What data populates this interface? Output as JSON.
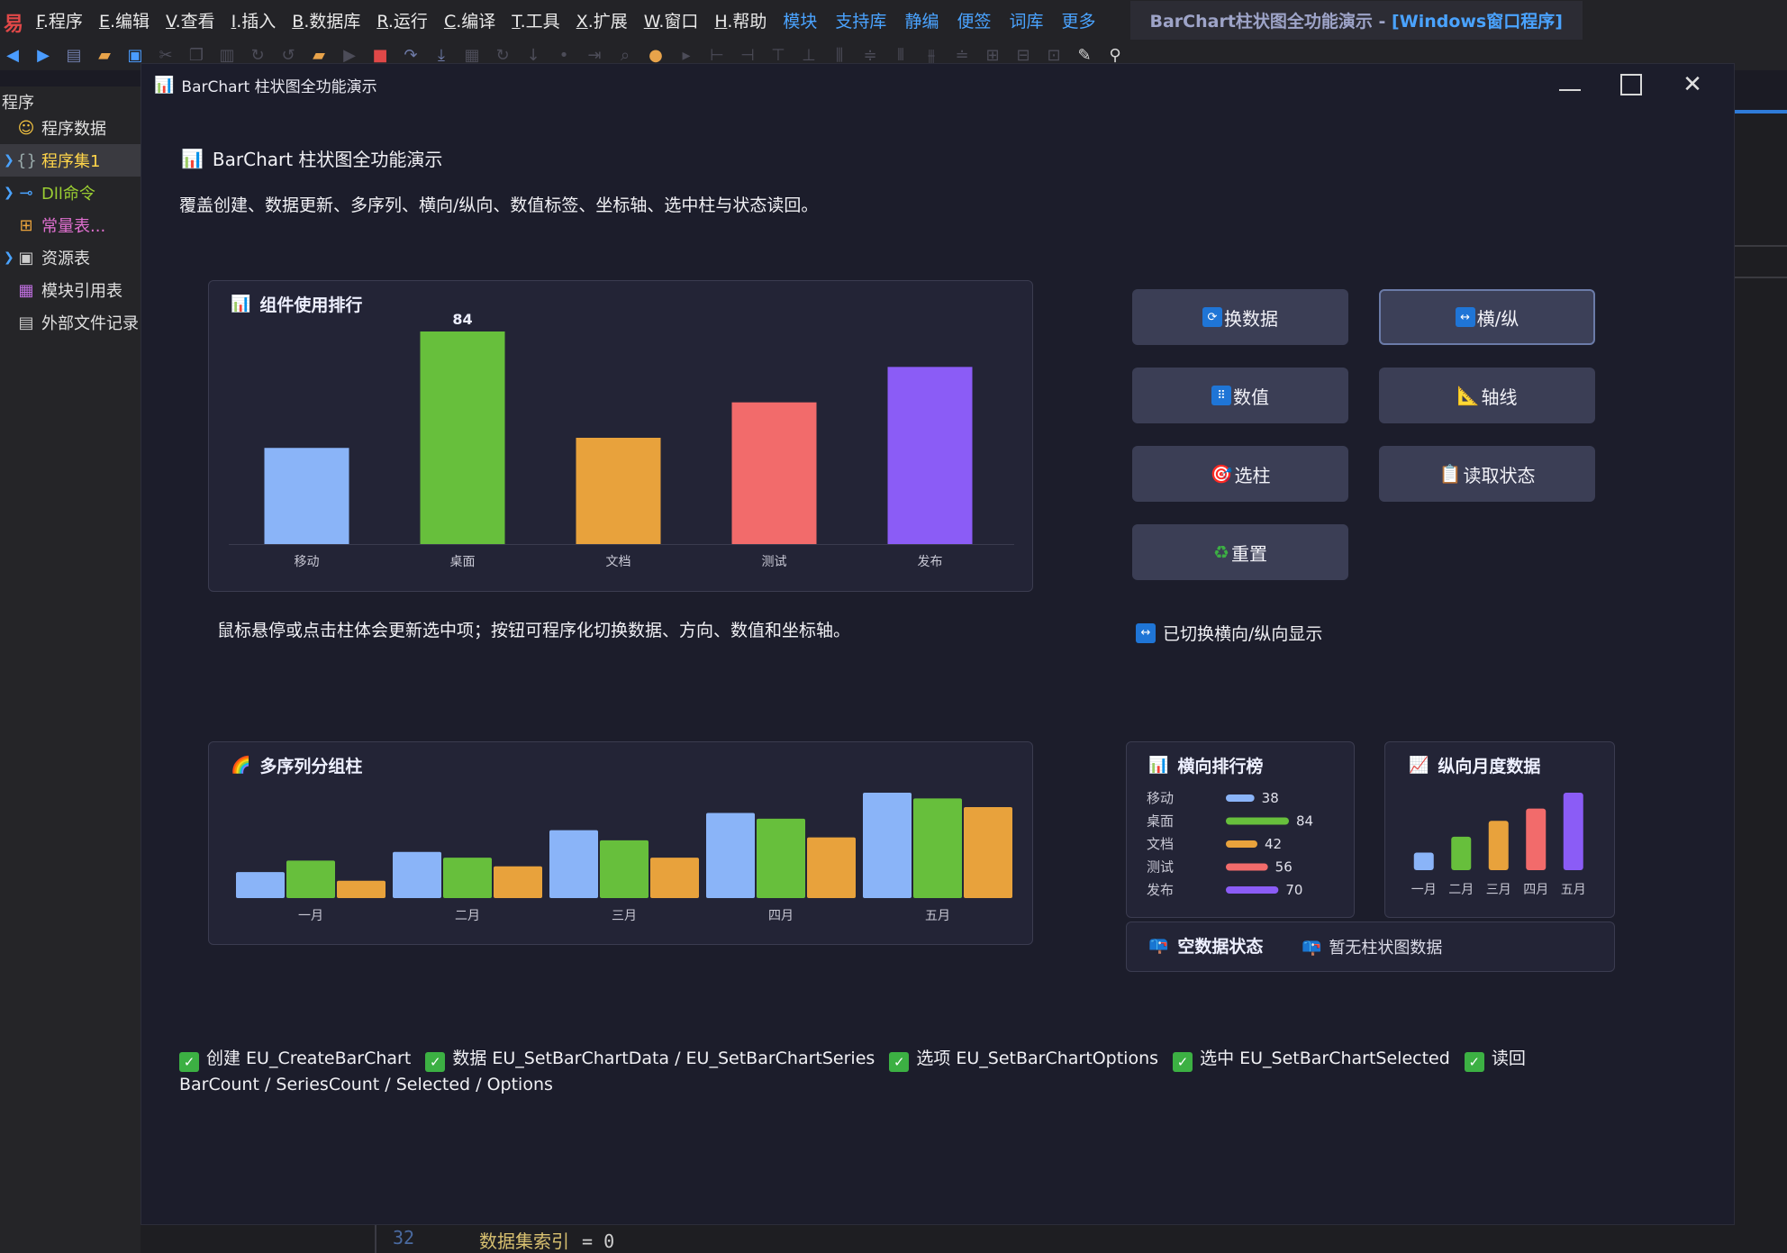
{
  "ide": {
    "menus": [
      {
        "key": "F",
        "label": ".程序"
      },
      {
        "key": "E",
        "label": ".编辑"
      },
      {
        "key": "V",
        "label": ".查看"
      },
      {
        "key": "I",
        "label": ".插入"
      },
      {
        "key": "B",
        "label": ".数据库"
      },
      {
        "key": "R",
        "label": ".运行"
      },
      {
        "key": "C",
        "label": ".编译"
      },
      {
        "key": "T",
        "label": ".工具"
      },
      {
        "key": "X",
        "label": ".扩展"
      },
      {
        "key": "W",
        "label": ".窗口"
      },
      {
        "key": "H",
        "label": ".帮助"
      }
    ],
    "links": [
      "模块",
      "支持库",
      "静编",
      "便签",
      "词库",
      "更多"
    ],
    "title_main": "BarChart柱状图全功能演示 - ",
    "title_sub": "[Windows窗口程序]",
    "sidebar_header": "程序",
    "sidebar_items": [
      {
        "label": "程序数据",
        "icon": "smiley-icon"
      },
      {
        "label": "程序集1",
        "icon": "braces-icon"
      },
      {
        "label": "Dll命令",
        "icon": "dll-icon"
      },
      {
        "label": "常量表...",
        "icon": "constant-icon"
      },
      {
        "label": "资源表",
        "icon": "resource-icon"
      },
      {
        "label": "模块引用表",
        "icon": "module-icon"
      },
      {
        "label": "外部文件记录",
        "icon": "file-icon"
      }
    ],
    "code_line_number": "32",
    "code_text": "数据集索引",
    "code_op": "=  0"
  },
  "window": {
    "title": "BarChart 柱状图全功能演示"
  },
  "page": {
    "title": "BarChart 柱状图全功能演示",
    "description": "覆盖创建、数据更新、多序列、横向/纵向、数值标签、坐标轴、选中柱与状态读回。",
    "hint": "鼠标悬停或点击柱体会更新选中项；按钮可程序化切换数据、方向、数值和坐标轴。",
    "status": "已切换横向/纵向显示",
    "empty_title": "空数据状态",
    "empty_text": "暂无柱状图数据"
  },
  "buttons": {
    "change_data": "换数据",
    "orientation": "横/纵",
    "values": "数值",
    "axis": "轴线",
    "select": "选柱",
    "read_state": "读取状态",
    "reset": "重置"
  },
  "api": [
    {
      "label": "创建 EU_CreateBarChart"
    },
    {
      "label": "数据 EU_SetBarChartData / EU_SetBarChartSeries"
    },
    {
      "label": "选项 EU_SetBarChartOptions"
    },
    {
      "label": "选中 EU_SetBarChartSelected"
    },
    {
      "label": "读回 BarCount / SeriesCount / Selected / Options"
    }
  ],
  "colors": {
    "blue": "#8ab4f8",
    "green": "#67bf3c",
    "orange": "#e8a23c",
    "red": "#f26b6b",
    "purple": "#8b5cf6"
  },
  "chart_data": [
    {
      "id": "ranking",
      "type": "bar",
      "title": "组件使用排行",
      "categories": [
        "移动",
        "桌面",
        "文档",
        "测试",
        "发布"
      ],
      "values": [
        38,
        84,
        42,
        56,
        70
      ],
      "colors": [
        "#8ab4f8",
        "#67bf3c",
        "#e8a23c",
        "#f26b6b",
        "#8b5cf6"
      ],
      "labeled_value": {
        "index": 1,
        "text": "84"
      },
      "ylim": [
        0,
        84
      ]
    },
    {
      "id": "multi",
      "type": "bar",
      "title": "多序列分组柱",
      "categories": [
        "一月",
        "二月",
        "三月",
        "四月",
        "五月"
      ],
      "series": [
        {
          "values": [
            18,
            32,
            47,
            59,
            73
          ],
          "color": "#8ab4f8"
        },
        {
          "values": [
            26,
            28,
            40,
            55,
            69
          ],
          "color": "#67bf3c"
        },
        {
          "values": [
            12,
            22,
            28,
            42,
            63
          ],
          "color": "#e8a23c"
        }
      ],
      "ylim": [
        0,
        73
      ]
    },
    {
      "id": "horizontal",
      "type": "bar",
      "orientation": "horizontal",
      "title": "横向排行榜",
      "categories": [
        "移动",
        "桌面",
        "文档",
        "测试",
        "发布"
      ],
      "values": [
        38,
        84,
        42,
        56,
        70
      ],
      "colors": [
        "#8ab4f8",
        "#67bf3c",
        "#e8a23c",
        "#f26b6b",
        "#8b5cf6"
      ],
      "xlim": [
        0,
        84
      ]
    },
    {
      "id": "monthly",
      "type": "bar",
      "title": "纵向月度数据",
      "categories": [
        "一月",
        "二月",
        "三月",
        "四月",
        "五月"
      ],
      "values": [
        20,
        38,
        56,
        70,
        88
      ],
      "colors": [
        "#8ab4f8",
        "#67bf3c",
        "#e8a23c",
        "#f26b6b",
        "#8b5cf6"
      ],
      "ylim": [
        0,
        88
      ]
    }
  ]
}
